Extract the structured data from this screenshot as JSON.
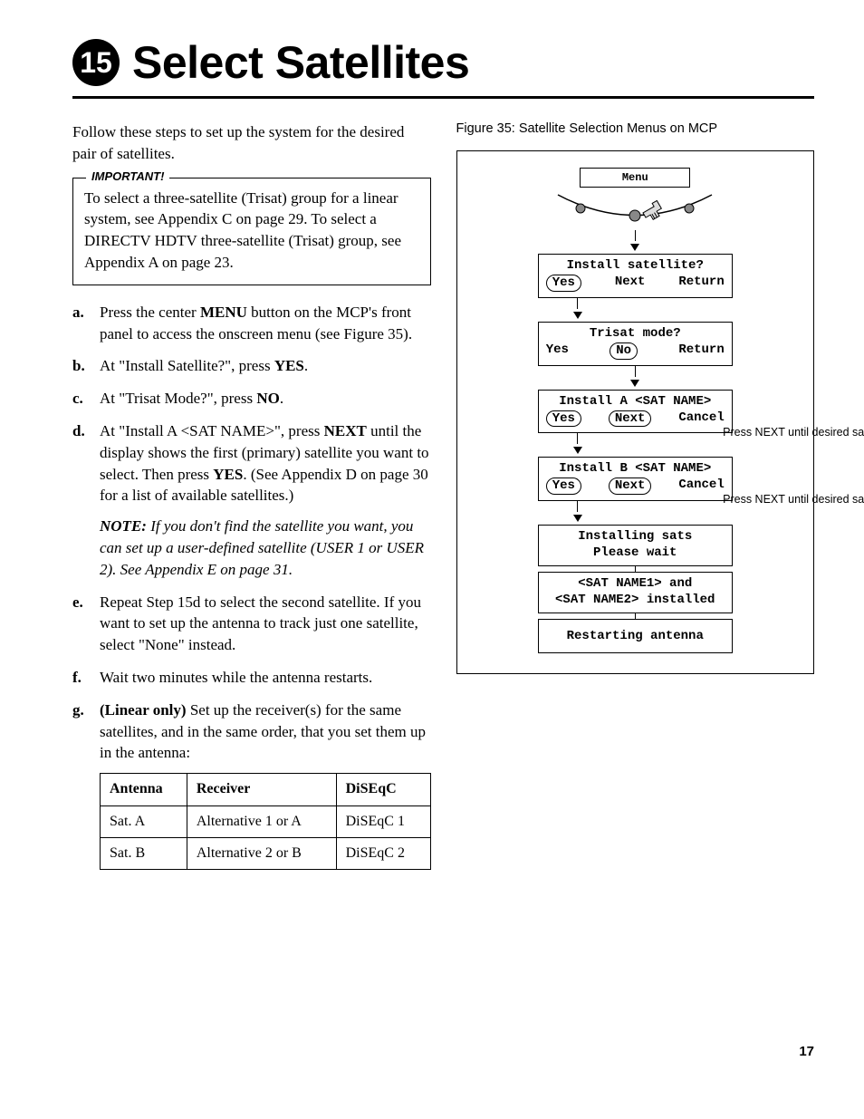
{
  "step_number": "15",
  "title": "Select Satellites",
  "intro": "Follow these steps to set up the system for the desired pair of satellites.",
  "important": {
    "legend": "IMPORTANT!",
    "text": "To select a three-satellite (Trisat) group for a linear system, see Appendix C on page 29. To select a DIRECTV HDTV three-satellite (Trisat) group, see Appendix A on page 23."
  },
  "steps": {
    "a": {
      "letter": "a.",
      "pre": "Press the center ",
      "bold": "MENU",
      "post": " button on the MCP's front panel to access the onscreen menu (see Figure 35)."
    },
    "b": {
      "letter": "b.",
      "pre": "At \"Install Satellite?\", press ",
      "bold": "YES",
      "post": "."
    },
    "c": {
      "letter": "c.",
      "pre": "At \"Trisat Mode?\", press ",
      "bold": "NO",
      "post": "."
    },
    "d": {
      "letter": "d.",
      "pre": "At \"Install A <SAT NAME>\", press ",
      "bold": "NEXT",
      "post": " until the display shows the first (primary) satellite you want to select. Then press ",
      "bold2": "YES",
      "post2": ". (See Appendix D on page 30 for a list of available satellites.)"
    },
    "d_note": {
      "lead": "NOTE:",
      "body": " If you don't find the satellite you want, you can set up a user-defined satellite (USER 1 or USER 2). See Appendix E on page 31."
    },
    "e": {
      "letter": "e.",
      "text": "Repeat Step 15d to select the second satellite. If you want to set up the antenna to track just one satellite, select \"None\" instead."
    },
    "f": {
      "letter": "f.",
      "text": "Wait two minutes while the antenna restarts."
    },
    "g": {
      "letter": "g.",
      "bold": "(Linear only)",
      "post": " Set up the receiver(s) for the same satellites, and in the same order, that you set them up in the antenna:"
    }
  },
  "table": {
    "headers": {
      "c1": "Antenna",
      "c2": "Receiver",
      "c3": "DiSEqC"
    },
    "rows": [
      {
        "c1": "Sat. A",
        "c2": "Alternative 1 or A",
        "c3": "DiSEqC 1"
      },
      {
        "c1": "Sat. B",
        "c2": "Alternative 2 or B",
        "c3": "DiSEqC 2"
      }
    ]
  },
  "figure": {
    "caption": "Figure 35:  Satellite Selection Menus on MCP",
    "mcp_label": "Menu",
    "boxes": {
      "install_sat": {
        "l1": "Install satellite?",
        "yes": "Yes",
        "mid": "Next",
        "right": "Return"
      },
      "trisat": {
        "l1": "Trisat mode?",
        "yes": "Yes",
        "mid": "No",
        "right": "Return"
      },
      "install_a": {
        "l1": "Install A <SAT NAME>",
        "yes": "Yes",
        "mid": "Next",
        "right": "Cancel"
      },
      "install_b": {
        "l1": "Install B <SAT NAME>",
        "yes": "Yes",
        "mid": "Next",
        "right": "Cancel"
      },
      "installing": {
        "l1": "Installing sats",
        "l2": "Please wait"
      },
      "installed": {
        "l1": "<SAT NAME1> and",
        "l2": "<SAT NAME2> installed"
      },
      "restart": {
        "l1": "Restarting antenna"
      }
    },
    "side_note": "Press NEXT until desired satellite shown"
  },
  "page_number": "17"
}
